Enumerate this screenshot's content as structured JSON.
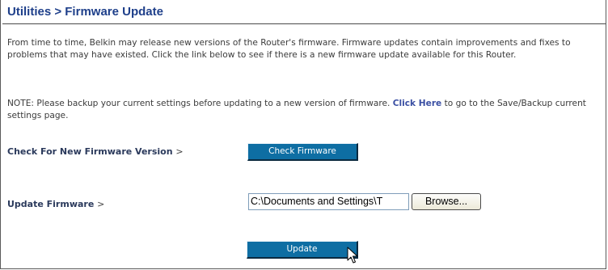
{
  "page": {
    "title": "Utilities > Firmware Update"
  },
  "intro": {
    "text": "From time to time, Belkin may release new versions of the Router's firmware. Firmware updates contain improvements and fixes to problems that may have existed. Click the link below to see if there is a new firmware update available for this Router."
  },
  "note": {
    "prefix": "NOTE: Please backup your current settings before updating to a new version of firmware. ",
    "link_label": "Click Here",
    "suffix": " to go to the Save/Backup current settings page."
  },
  "check_row": {
    "label": "Check For New Firmware Version",
    "arrow": ">",
    "button_label": "Check Firmware"
  },
  "update_row": {
    "label": "Update Firmware",
    "arrow": ">",
    "file_value": "C:\\Documents and Settings\\T",
    "browse_label": "Browse...",
    "button_label": "Update"
  },
  "icons": {
    "cursor": "mouse-pointer-icon"
  },
  "colors": {
    "title": "#1e3f8a",
    "button_bg": "#0e6ea3",
    "link": "#3a4fa3"
  }
}
